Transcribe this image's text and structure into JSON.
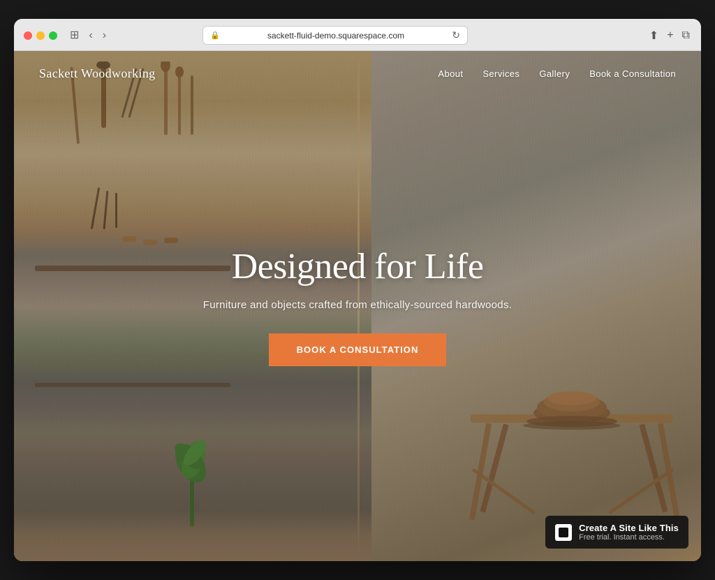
{
  "browser": {
    "url": "sackett-fluid-demo.squarespace.com",
    "back_btn": "‹",
    "forward_btn": "›"
  },
  "nav": {
    "logo": "Sackett Woodworking",
    "links": [
      {
        "label": "About",
        "href": "#"
      },
      {
        "label": "Services",
        "href": "#"
      },
      {
        "label": "Gallery",
        "href": "#"
      },
      {
        "label": "Book a Consultation",
        "href": "#"
      }
    ]
  },
  "hero": {
    "title": "Designed for Life",
    "subtitle": "Furniture and objects crafted from ethically-sourced hardwoods.",
    "cta_label": "Book a Consultation"
  },
  "badge": {
    "main_text": "Create A Site Like This",
    "sub_text": "Free trial. Instant access."
  }
}
